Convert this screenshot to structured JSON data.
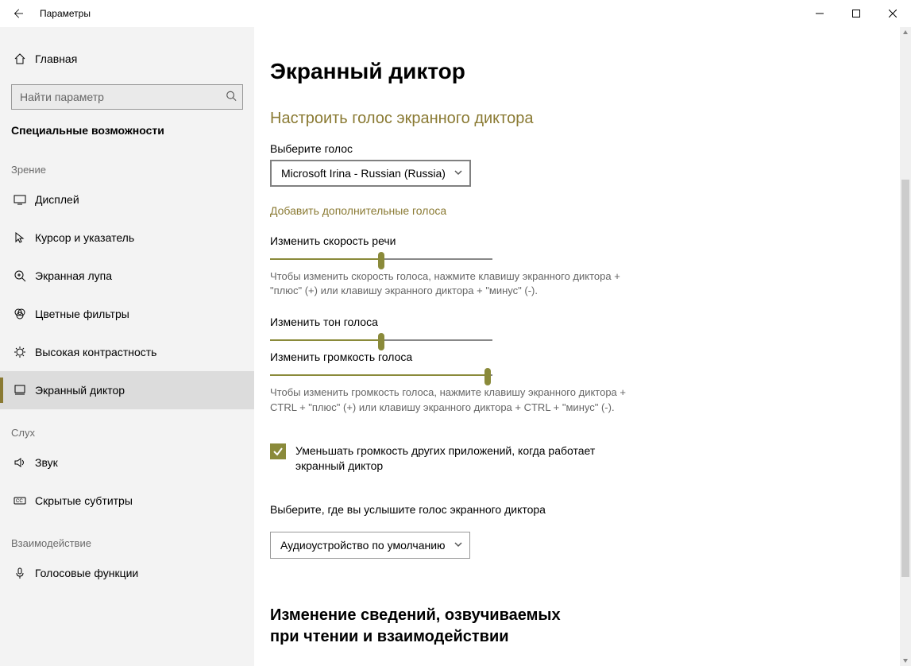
{
  "window": {
    "title": "Параметры"
  },
  "sidebar": {
    "home_label": "Главная",
    "search_placeholder": "Найти параметр",
    "category_title": "Специальные возможности",
    "groups": [
      {
        "label": "Зрение",
        "items": [
          {
            "id": "display",
            "label": "Дисплей"
          },
          {
            "id": "cursor",
            "label": "Курсор и указатель"
          },
          {
            "id": "magnifier",
            "label": "Экранная лупа"
          },
          {
            "id": "filters",
            "label": "Цветные фильтры"
          },
          {
            "id": "contrast",
            "label": "Высокая контрастность"
          },
          {
            "id": "narrator",
            "label": "Экранный диктор",
            "selected": true
          }
        ]
      },
      {
        "label": "Слух",
        "items": [
          {
            "id": "sound",
            "label": "Звук"
          },
          {
            "id": "captions",
            "label": "Скрытые субтитры"
          }
        ]
      },
      {
        "label": "Взаимодействие",
        "items": [
          {
            "id": "speech",
            "label": "Голосовые функции"
          }
        ]
      }
    ]
  },
  "page": {
    "title": "Экранный диктор",
    "voice_section": "Настроить голос экранного диктора",
    "choose_voice_label": "Выберите голос",
    "voice_selected": "Microsoft Irina - Russian (Russia)",
    "add_voices_link": "Добавить дополнительные голоса",
    "speed_label": "Изменить скорость речи",
    "speed_value_pct": 50,
    "speed_help": "Чтобы изменить скорость голоса, нажмите клавишу экранного диктора + \"плюс\" (+) или клавишу экранного диктора + \"минус\" (-).",
    "pitch_label": "Изменить тон голоса",
    "pitch_value_pct": 50,
    "volume_label": "Изменить громкость голоса",
    "volume_value_pct": 98,
    "volume_help": "Чтобы изменить громкость голоса, нажмите клавишу экранного диктора + CTRL + \"плюс\" (+) или клавишу экранного диктора + CTRL + \"минус\" (-).",
    "lower_volume_checkbox": "Уменьшать громкость других приложений, когда работает экранный диктор",
    "lower_volume_checked": true,
    "output_label": "Выберите, где вы услышите голос экранного диктора",
    "output_selected": "Аудиоустройство по умолчанию",
    "info_section": "Изменение сведений, озвучиваемых при чтении и взаимодействии"
  }
}
